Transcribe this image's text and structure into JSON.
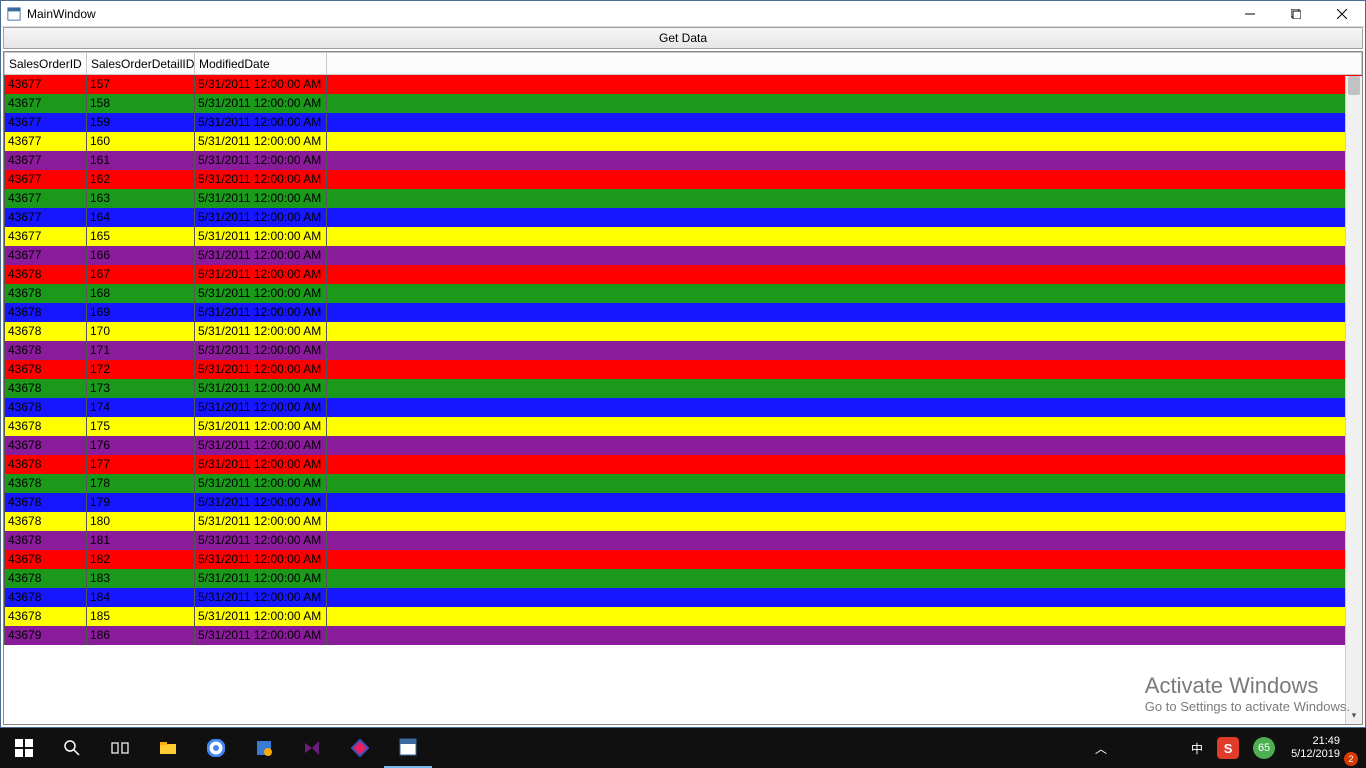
{
  "window": {
    "title": "MainWindow"
  },
  "button": {
    "get_data": "Get Data"
  },
  "columns": [
    "SalesOrderID",
    "SalesOrderDetailID",
    "ModifiedDate"
  ],
  "row_colors": [
    "#ff0000",
    "#1a991a",
    "#1717ff",
    "#ffff00",
    "#8a1b9a"
  ],
  "rows": [
    {
      "sid": "43677",
      "did": "157",
      "date": "5/31/2011 12:00:00 AM",
      "c": 0
    },
    {
      "sid": "43677",
      "did": "158",
      "date": "5/31/2011 12:00:00 AM",
      "c": 1
    },
    {
      "sid": "43677",
      "did": "159",
      "date": "5/31/2011 12:00:00 AM",
      "c": 2
    },
    {
      "sid": "43677",
      "did": "160",
      "date": "5/31/2011 12:00:00 AM",
      "c": 3
    },
    {
      "sid": "43677",
      "did": "161",
      "date": "5/31/2011 12:00:00 AM",
      "c": 4
    },
    {
      "sid": "43677",
      "did": "162",
      "date": "5/31/2011 12:00:00 AM",
      "c": 0
    },
    {
      "sid": "43677",
      "did": "163",
      "date": "5/31/2011 12:00:00 AM",
      "c": 1
    },
    {
      "sid": "43677",
      "did": "164",
      "date": "5/31/2011 12:00:00 AM",
      "c": 2
    },
    {
      "sid": "43677",
      "did": "165",
      "date": "5/31/2011 12:00:00 AM",
      "c": 3
    },
    {
      "sid": "43677",
      "did": "166",
      "date": "5/31/2011 12:00:00 AM",
      "c": 4
    },
    {
      "sid": "43678",
      "did": "167",
      "date": "5/31/2011 12:00:00 AM",
      "c": 0
    },
    {
      "sid": "43678",
      "did": "168",
      "date": "5/31/2011 12:00:00 AM",
      "c": 1
    },
    {
      "sid": "43678",
      "did": "169",
      "date": "5/31/2011 12:00:00 AM",
      "c": 2
    },
    {
      "sid": "43678",
      "did": "170",
      "date": "5/31/2011 12:00:00 AM",
      "c": 3
    },
    {
      "sid": "43678",
      "did": "171",
      "date": "5/31/2011 12:00:00 AM",
      "c": 4
    },
    {
      "sid": "43678",
      "did": "172",
      "date": "5/31/2011 12:00:00 AM",
      "c": 0
    },
    {
      "sid": "43678",
      "did": "173",
      "date": "5/31/2011 12:00:00 AM",
      "c": 1
    },
    {
      "sid": "43678",
      "did": "174",
      "date": "5/31/2011 12:00:00 AM",
      "c": 2
    },
    {
      "sid": "43678",
      "did": "175",
      "date": "5/31/2011 12:00:00 AM",
      "c": 3
    },
    {
      "sid": "43678",
      "did": "176",
      "date": "5/31/2011 12:00:00 AM",
      "c": 4
    },
    {
      "sid": "43678",
      "did": "177",
      "date": "5/31/2011 12:00:00 AM",
      "c": 0
    },
    {
      "sid": "43678",
      "did": "178",
      "date": "5/31/2011 12:00:00 AM",
      "c": 1
    },
    {
      "sid": "43678",
      "did": "179",
      "date": "5/31/2011 12:00:00 AM",
      "c": 2
    },
    {
      "sid": "43678",
      "did": "180",
      "date": "5/31/2011 12:00:00 AM",
      "c": 3
    },
    {
      "sid": "43678",
      "did": "181",
      "date": "5/31/2011 12:00:00 AM",
      "c": 4
    },
    {
      "sid": "43678",
      "did": "182",
      "date": "5/31/2011 12:00:00 AM",
      "c": 0
    },
    {
      "sid": "43678",
      "did": "183",
      "date": "5/31/2011 12:00:00 AM",
      "c": 1
    },
    {
      "sid": "43678",
      "did": "184",
      "date": "5/31/2011 12:00:00 AM",
      "c": 2
    },
    {
      "sid": "43678",
      "did": "185",
      "date": "5/31/2011 12:00:00 AM",
      "c": 3
    },
    {
      "sid": "43679",
      "did": "186",
      "date": "5/31/2011 12:00:00 AM",
      "c": 4
    }
  ],
  "watermark": {
    "line1": "Activate Windows",
    "line2": "Go to Settings to activate Windows."
  },
  "taskbar": {
    "tray_badge": "65",
    "ime_lang": "中",
    "sogou": "S",
    "notif_count": "2",
    "clock_time": "21:49",
    "clock_date": "5/12/2019"
  }
}
